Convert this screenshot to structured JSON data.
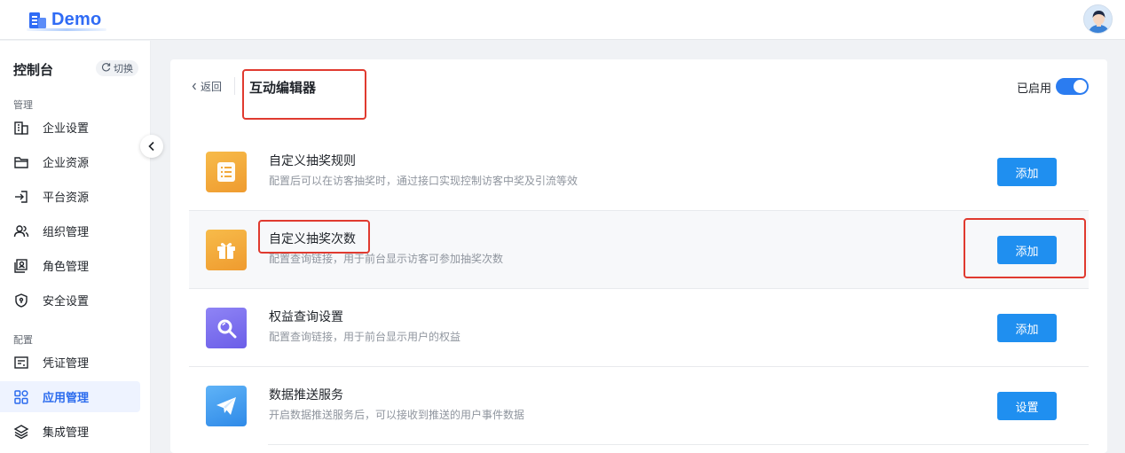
{
  "header": {
    "logo_text": "Demo"
  },
  "sidebar": {
    "title": "控制台",
    "switch_label": "切换",
    "section_manage": "管理",
    "section_config": "配置",
    "items": [
      {
        "label": "企业设置",
        "icon": "building-icon"
      },
      {
        "label": "企业资源",
        "icon": "folder-icon"
      },
      {
        "label": "平台资源",
        "icon": "login-icon"
      },
      {
        "label": "组织管理",
        "icon": "users-icon"
      },
      {
        "label": "角色管理",
        "icon": "role-icon"
      },
      {
        "label": "安全设置",
        "icon": "shield-icon"
      },
      {
        "label": "凭证管理",
        "icon": "credential-icon"
      },
      {
        "label": "应用管理",
        "icon": "apps-icon",
        "active": true
      },
      {
        "label": "集成管理",
        "icon": "layers-icon"
      }
    ]
  },
  "page": {
    "back_label": "返回",
    "title": "互动编辑器",
    "enabled_label": "已启用",
    "enabled": true
  },
  "rows": [
    {
      "title": "自定义抽奖规则",
      "desc": "配置后可以在访客抽奖时，通过接口实现控制访客中奖及引流等效",
      "button": "添加",
      "icon": "list-doc-icon"
    },
    {
      "title": "自定义抽奖次数",
      "desc": "配置查询链接，用于前台显示访客可参加抽奖次数",
      "button": "添加",
      "icon": "gift-icon"
    },
    {
      "title": "权益查询设置",
      "desc": "配置查询链接，用于前台显示用户的权益",
      "button": "添加",
      "icon": "search-icon"
    },
    {
      "title": "数据推送服务",
      "desc": "开启数据推送服务后，可以接收到推送的用户事件数据",
      "button": "设置",
      "icon": "send-icon"
    }
  ],
  "colors": {
    "accent": "#1f8ff0",
    "brand": "#2f6bf5",
    "highlight": "#e03a2f",
    "orange_icon": "#f2a93b",
    "purple_icon": "#7b6ff0",
    "blue_icon": "#3a9af0"
  }
}
